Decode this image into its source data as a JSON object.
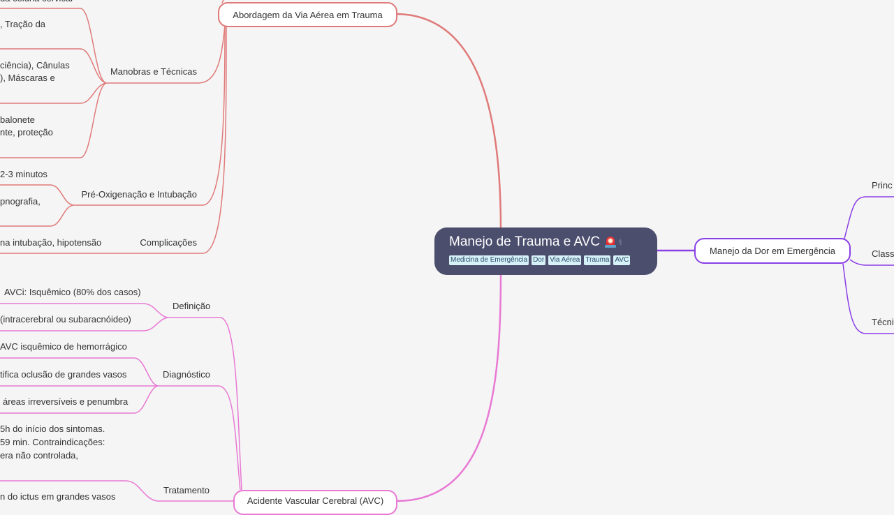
{
  "root": {
    "title": "Manejo de Trauma e AVC",
    "icon": "siren-icon",
    "tags": [
      "Medicina de Emergência",
      "Dor",
      "Via Aérea",
      "Trauma",
      "AVC"
    ],
    "background": "#4b4e6d"
  },
  "branches": {
    "trauma": {
      "label": "Abordagem da Via Aérea em Trauma",
      "color": "#e07a7a",
      "subtopics": [
        {
          "label": "Manobras e Técnicas",
          "leaves": [
            "da coluna cervical",
            ", Tração da",
            "ciência), Cânulas",
            "), Máscaras e",
            "balonete",
            "nte, proteção"
          ]
        },
        {
          "label": "Pré-Oxigenação e Intubação",
          "leaves": [
            "2-3 minutos",
            "pnografia,"
          ]
        },
        {
          "label": "Complicações",
          "leaves": [
            "na intubação, hipotensão"
          ]
        }
      ]
    },
    "avc": {
      "label": "Acidente Vascular Cerebral (AVC)",
      "color": "#e879d4",
      "subtopics": [
        {
          "label": "Definição",
          "leaves": [
            "AVCi: Isquêmico (80% dos casos)",
            "(intracerebral ou subaracnóideo)"
          ]
        },
        {
          "label": "Diagnóstico",
          "leaves": [
            "AVC isquêmico de hemorrágico",
            "tifica oclusão de grandes vasos",
            "áreas irreversíveis e penumbra"
          ]
        },
        {
          "label": "Tratamento",
          "leaves": [
            "5h do início dos sintomas.",
            " 59 min. Contraindicações:",
            "era não controlada,",
            "n do ictus em grandes vasos"
          ]
        }
      ]
    },
    "dor": {
      "label": "Manejo da Dor em Emergência",
      "color": "#8a3ee6",
      "subtopics": [
        {
          "label": "Princ"
        },
        {
          "label": "Class"
        },
        {
          "label": "Técni"
        }
      ]
    }
  }
}
